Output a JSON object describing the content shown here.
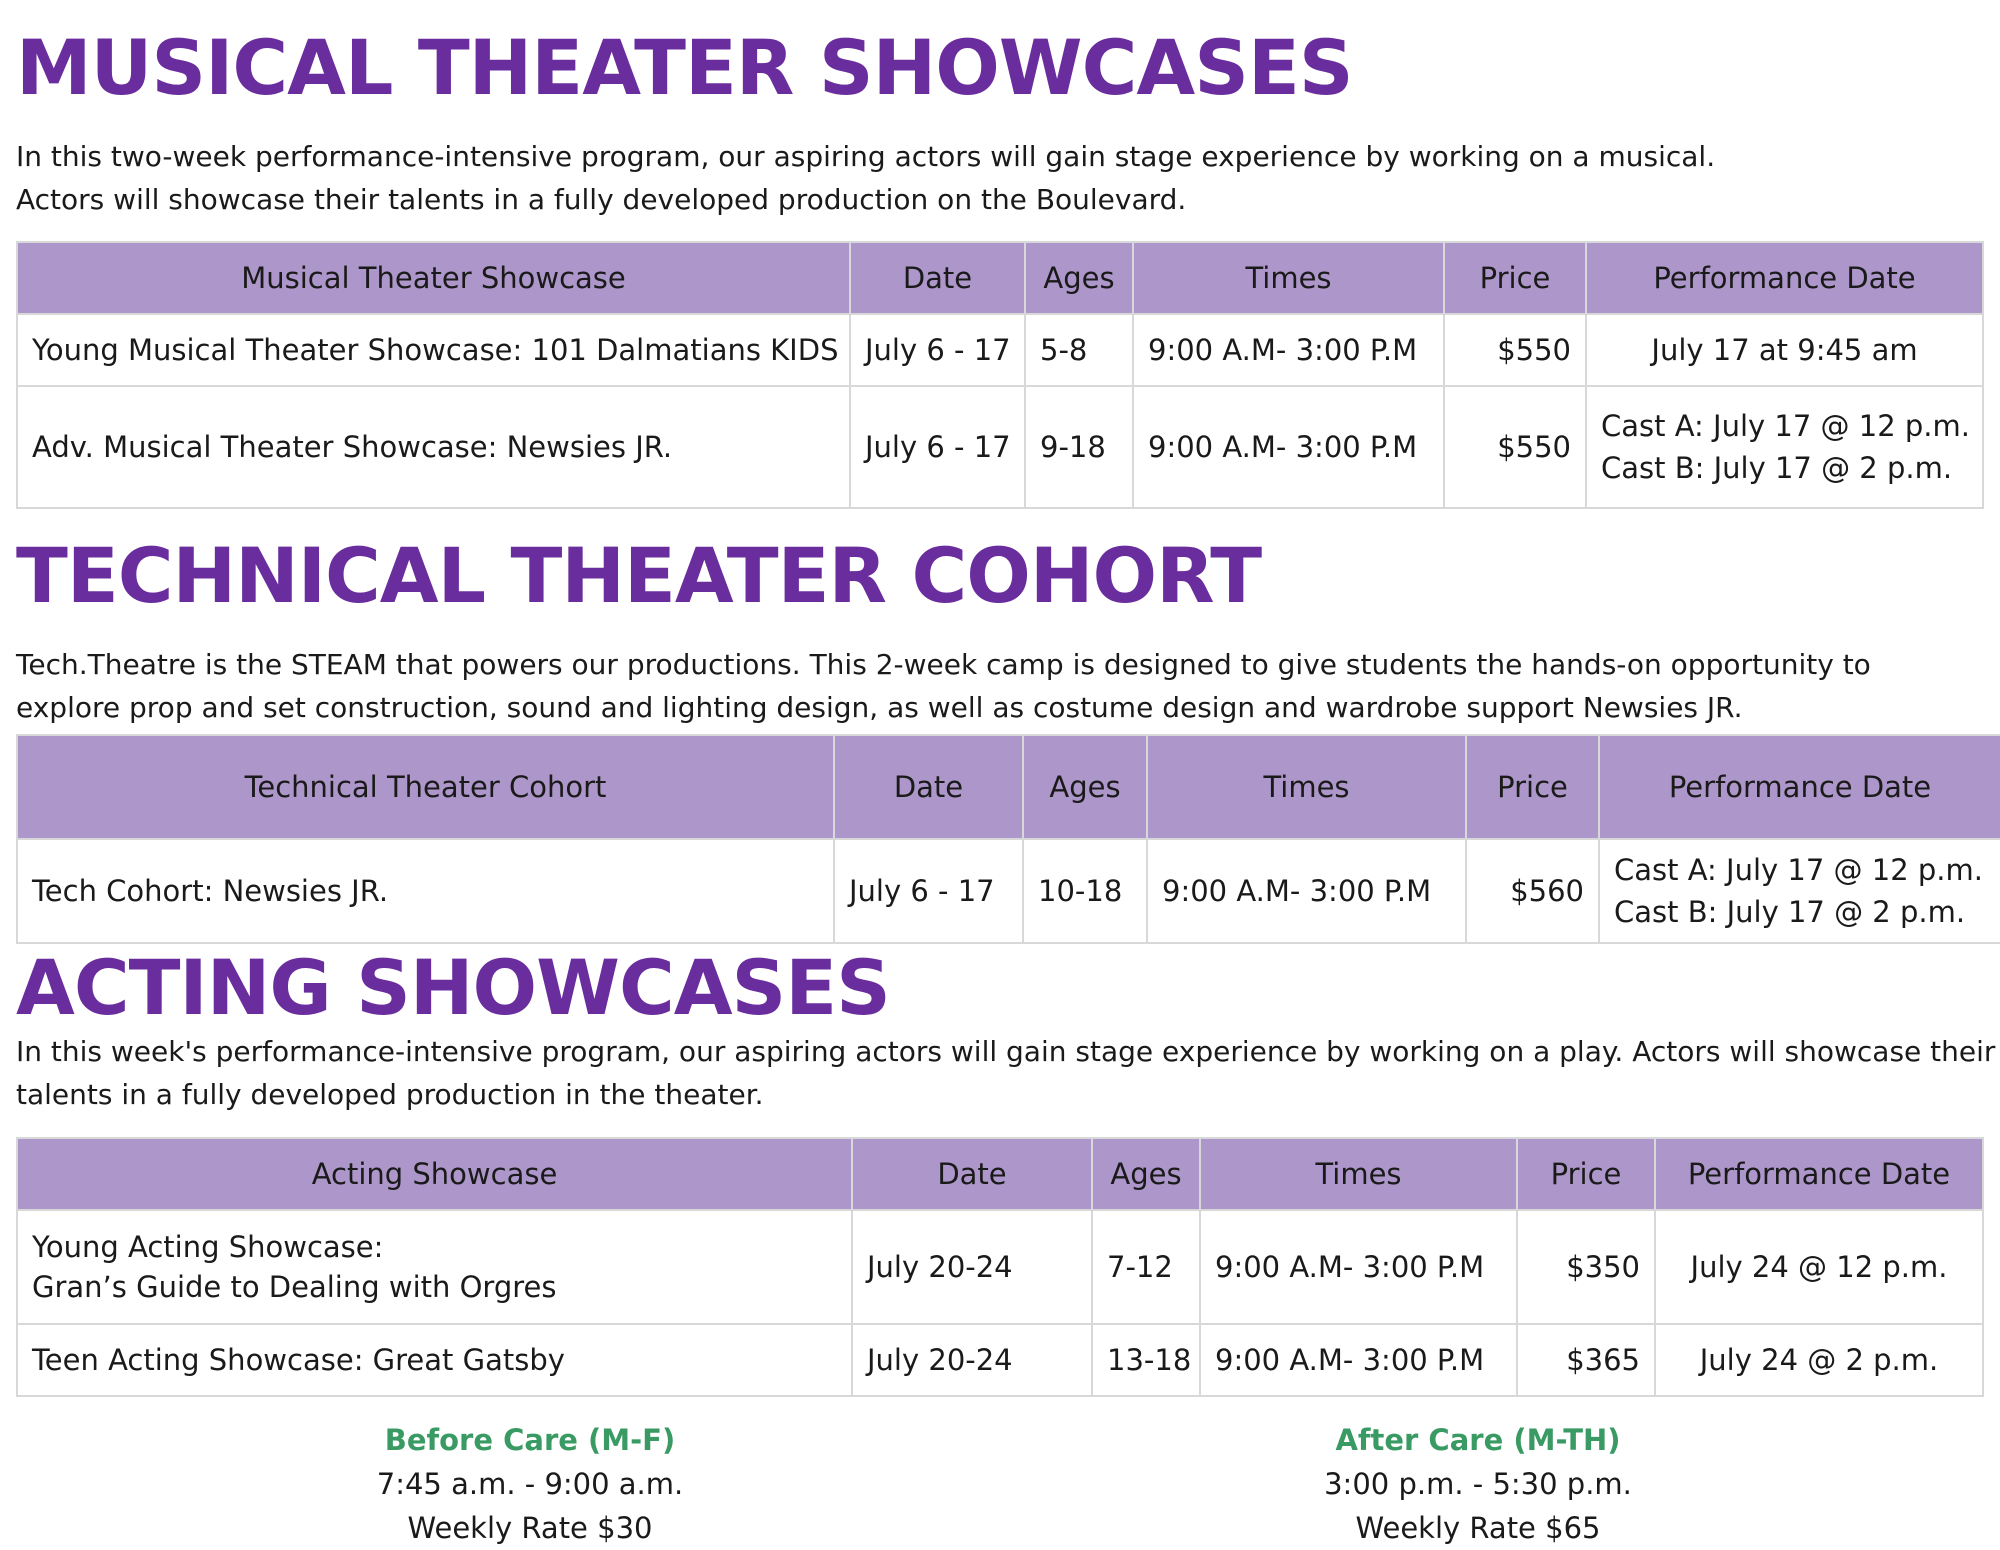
{
  "musical": {
    "heading": "Musical Theater Showcases",
    "desc1": "In this two-week performance-intensive program, our aspiring actors will gain stage experience by working on a musical.",
    "desc2": "Actors will showcase their talents in a fully developed production on the Boulevard.",
    "headers": [
      "Musical Theater Showcase",
      "Date",
      "Ages",
      "Times",
      "Price",
      "Performance Date"
    ],
    "rows": [
      {
        "name": "Young Musical Theater Showcase: 101 Dalmatians KIDS",
        "date": "July 6 - 17",
        "ages": "5-8",
        "times": "9:00 A.M- 3:00 P.M",
        "price": "$550",
        "perf1": "July 17 at 9:45 am"
      },
      {
        "name": "Adv. Musical Theater Showcase: Newsies JR.",
        "date": "July 6 - 17",
        "ages": "9-18",
        "times": "9:00 A.M- 3:00 P.M",
        "price": "$550",
        "perf1": "Cast A: July 17 @ 12 p.m.",
        "perf2": "Cast B: July 17 @ 2 p.m."
      }
    ]
  },
  "technical": {
    "heading": "Technical Theater Cohort",
    "desc1": "Tech.Theatre is the STEAM that powers our productions. This 2-week camp is designed to give students the hands-on opportunity to",
    "desc2": "explore prop and set construction, sound and lighting design, as well as costume design and wardrobe support Newsies JR.",
    "headers": [
      "Technical Theater Cohort",
      "Date",
      "Ages",
      "Times",
      "Price",
      "Performance Date"
    ],
    "rows": [
      {
        "name": "Tech Cohort: Newsies JR.",
        "date": "July 6 - 17",
        "ages": "10-18",
        "times": "9:00 A.M- 3:00 P.M",
        "price": "$560",
        "perf1": "Cast A: July 17 @ 12 p.m.",
        "perf2": "Cast B: July 17 @ 2 p.m."
      }
    ]
  },
  "acting": {
    "heading": "Acting Showcases",
    "desc1": "In this week's performance-intensive program, our aspiring actors will gain stage experience by working on a play. Actors will showcase their",
    "desc2": "talents in a fully developed production in the theater.",
    "headers": [
      "Acting Showcase",
      "Date",
      "Ages",
      "Times",
      "Price",
      "Performance Date"
    ],
    "rows": [
      {
        "name1": "Young Acting Showcase:",
        "name2": "Gran’s Guide to Dealing with Orgres",
        "date": "July 20-24",
        "ages": "7-12",
        "times": "9:00 A.M- 3:00 P.M",
        "price": "$350",
        "perf1": "July 24 @ 12 p.m."
      },
      {
        "name1": "Teen Acting Showcase: Great Gatsby",
        "date": "July 20-24",
        "ages": "13-18",
        "times": "9:00 A.M- 3:00 P.M",
        "price": "$365",
        "perf1": "July 24 @ 2 p.m."
      }
    ]
  },
  "care": {
    "before": {
      "title": "Before Care (M-F)",
      "hours": "7:45 a.m. - 9:00 a.m.",
      "rate": "Weekly Rate $30"
    },
    "after": {
      "title": "After Care (M-TH)",
      "hours": "3:00 p.m. - 5:30 p.m.",
      "rate": "Weekly Rate $65"
    }
  },
  "colors": {
    "heading": "#6a2d9e",
    "header_bg": "#ad96c9",
    "care_title": "#3a9a63"
  }
}
